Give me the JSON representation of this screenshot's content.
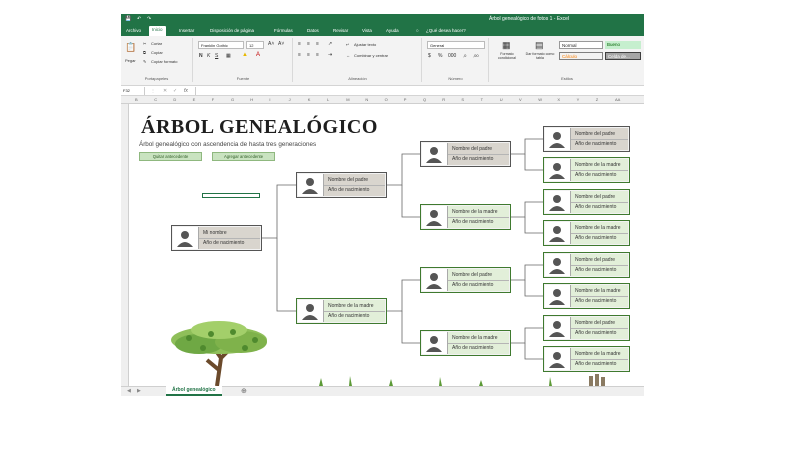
{
  "window": {
    "title": "Árbol genealógico de fotos 1  -  Excel",
    "search_hint": "¿Qué desea hacer?"
  },
  "ribbon_tabs": [
    "Archivo",
    "Inicio",
    "Insertar",
    "Disposición de página",
    "Fórmulas",
    "Datos",
    "Revisar",
    "Vista",
    "Ayuda"
  ],
  "ribbon": {
    "paste": "Pegar",
    "cut": "Cortar",
    "copy": "Copiar",
    "format_painter": "Copiar formato",
    "clipboard_group": "Portapapeles",
    "font_name": "Franklin Gothic",
    "font_size": "12",
    "font_group": "Fuente",
    "wrap_text": "Ajustar texto",
    "merge": "Combinar y centrar",
    "alignment_group": "Alineación",
    "number_format": "General",
    "number_group": "Número",
    "conditional": "Formato condicional",
    "format_table": "Dar formato como tabla",
    "style_normal": "Normal",
    "style_good": "Bueno",
    "style_calc": "Cálculo",
    "style_check": "Celda de...",
    "styles_group": "Estilos"
  },
  "formula_bar": {
    "name_box": "F32",
    "value": ""
  },
  "columns": [
    "B",
    "C",
    "D",
    "E",
    "F",
    "G",
    "H",
    "I",
    "J",
    "K",
    "L",
    "M",
    "N",
    "O",
    "P",
    "Q",
    "R",
    "S",
    "T",
    "U",
    "V",
    "W",
    "X",
    "Y",
    "Z",
    "AA"
  ],
  "sheet": {
    "title": "ÁRBOL GENEALÓGICO",
    "subtitle": "Árbol genealógico con ascendencia de hasta tres generaciones",
    "remove_button": "Quitar antecedente",
    "add_button": "Agregar antecedente"
  },
  "cards": {
    "me": {
      "name": "Mi nombre",
      "year": "Año de nacimiento"
    },
    "father": {
      "name": "Nombre del padre",
      "year": "Año de nacimiento"
    },
    "mother": {
      "name": "Nombre de la madre",
      "year": "Año de nacimiento"
    }
  },
  "sheet_tab": "Árbol genealógico",
  "colors": {
    "excel_green": "#217346",
    "card_gray": "#d9d5ce",
    "card_green": "#e2efd9"
  }
}
